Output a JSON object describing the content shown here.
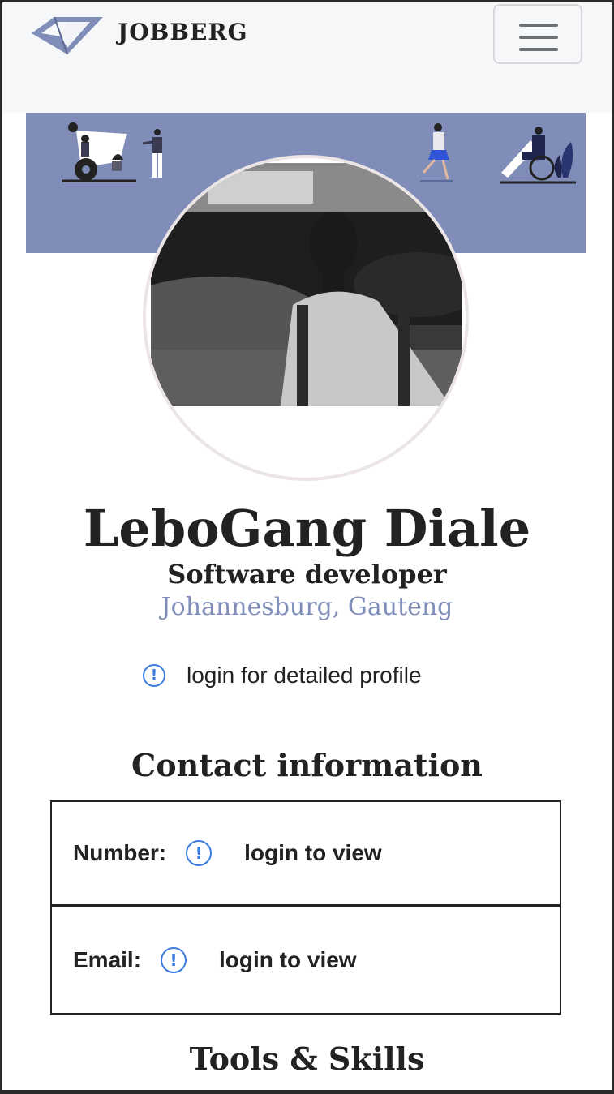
{
  "navbar": {
    "brand": "JOBBERG",
    "logo_icon": "diamond-logo-icon",
    "menu_icon": "hamburger-menu-icon"
  },
  "banner": {
    "color": "#7f8db8",
    "illustrations": [
      "person-with-film-reel",
      "person-walking",
      "person-running",
      "person-in-wheelchair"
    ]
  },
  "profile": {
    "avatar": "profile-photo",
    "name": "LeboGang Diale",
    "title": "Software developer",
    "location": "Johannesburg, Gauteng",
    "login_notice": "login for detailed profile"
  },
  "contact": {
    "heading": "Contact information",
    "rows": [
      {
        "label": "Number:",
        "value": "login to view"
      },
      {
        "label": "Email:",
        "value": "login to view"
      }
    ]
  },
  "skills": {
    "heading": "Tools & Skills"
  },
  "colors": {
    "accent": "#7f8db8",
    "info": "#3b7be0",
    "text": "#222222"
  }
}
